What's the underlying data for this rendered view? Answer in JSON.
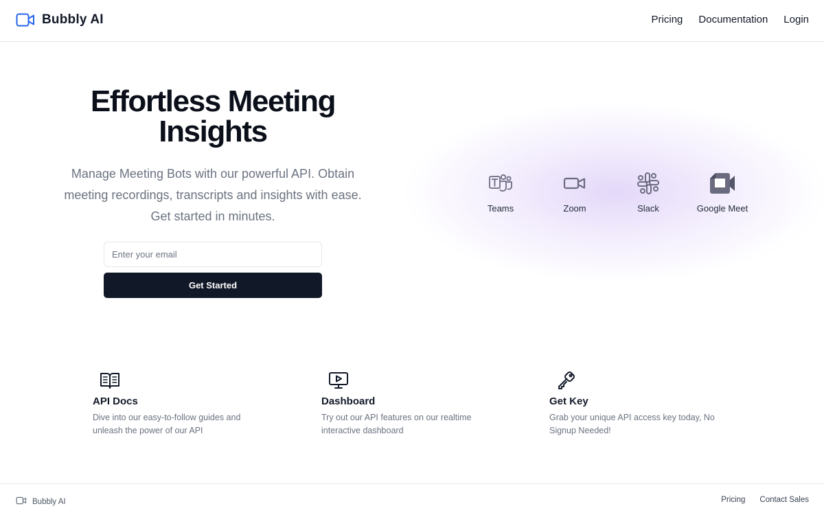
{
  "header": {
    "brand": "Bubbly AI",
    "nav": [
      "Pricing",
      "Documentation",
      "Login"
    ]
  },
  "hero": {
    "title": "Effortless Meeting Insights",
    "subtitle": "Manage Meeting Bots with our powerful API. Obtain meeting recordings, transcripts and insights with ease. Get started in minutes.",
    "email_placeholder": "Enter your email",
    "cta_label": "Get Started"
  },
  "platforms": [
    {
      "label": "Teams",
      "icon": "teams-icon"
    },
    {
      "label": "Zoom",
      "icon": "zoom-icon"
    },
    {
      "label": "Slack",
      "icon": "slack-icon"
    },
    {
      "label": "Google Meet",
      "icon": "google-meet-icon"
    }
  ],
  "features": [
    {
      "title": "API Docs",
      "desc": "Dive into our easy-to-follow guides and unleash the power of our API",
      "icon": "book-icon"
    },
    {
      "title": "Dashboard",
      "desc": "Try out our API features on our realtime interactive dashboard",
      "icon": "monitor-play-icon"
    },
    {
      "title": "Get Key",
      "desc": "Grab your unique API access key today, No Signup Needed!",
      "icon": "key-icon"
    }
  ],
  "footer": {
    "brand": "Bubbly AI",
    "links": [
      "Pricing",
      "Contact Sales"
    ]
  },
  "colors": {
    "brand_icon": "#2563eb",
    "button_bg": "#111827",
    "platform_icon": "#6b6b80",
    "glow": "#e3d7fa"
  }
}
